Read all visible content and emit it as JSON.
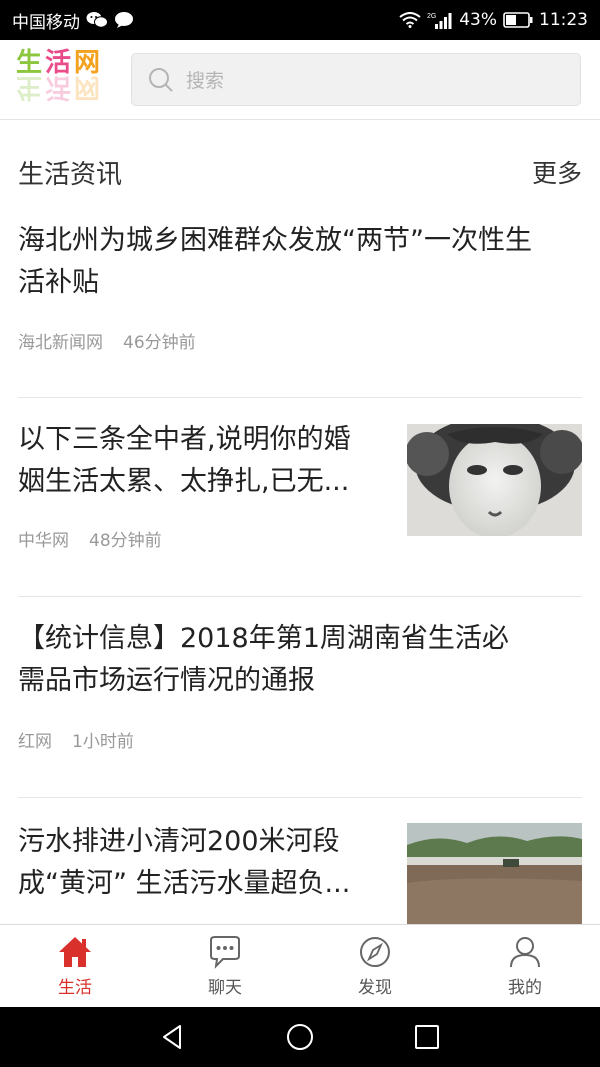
{
  "status_bar": {
    "carrier": "中国移动",
    "battery": "43%",
    "time": "11:23",
    "network": "2G"
  },
  "header": {
    "logo_chars": [
      "生",
      "活",
      "网"
    ],
    "search_placeholder": "搜索"
  },
  "section": {
    "title": "生活资讯",
    "more": "更多"
  },
  "news": [
    {
      "title_line1": "海北州为城乡困难群众发放“两节”一次性生",
      "title_line2": "活补贴",
      "source": "海北新闻网",
      "time": "46分钟前"
    },
    {
      "title_line1": "以下三条全中者,说明你的婚",
      "title_line2": "姻生活太累、太挣扎,已无...",
      "source": "中华网",
      "time": "48分钟前"
    },
    {
      "title_line1": "【统计信息】2018年第1周湖南省生活必",
      "title_line2": "需品市场运行情况的通报",
      "source": "红网",
      "time": "1小时前"
    },
    {
      "title_line1": "污水排进小清河200米河段",
      "title_line2": "成“黄河” 生活污水量超负..."
    }
  ],
  "tabs": [
    {
      "label": "生活",
      "icon": "home-icon",
      "active": true
    },
    {
      "label": "聊天",
      "icon": "chat-icon",
      "active": false
    },
    {
      "label": "发现",
      "icon": "compass-icon",
      "active": false
    },
    {
      "label": "我的",
      "icon": "user-icon",
      "active": false
    }
  ],
  "colors": {
    "accent": "#d9302b",
    "text": "#222222",
    "meta": "#999999"
  }
}
